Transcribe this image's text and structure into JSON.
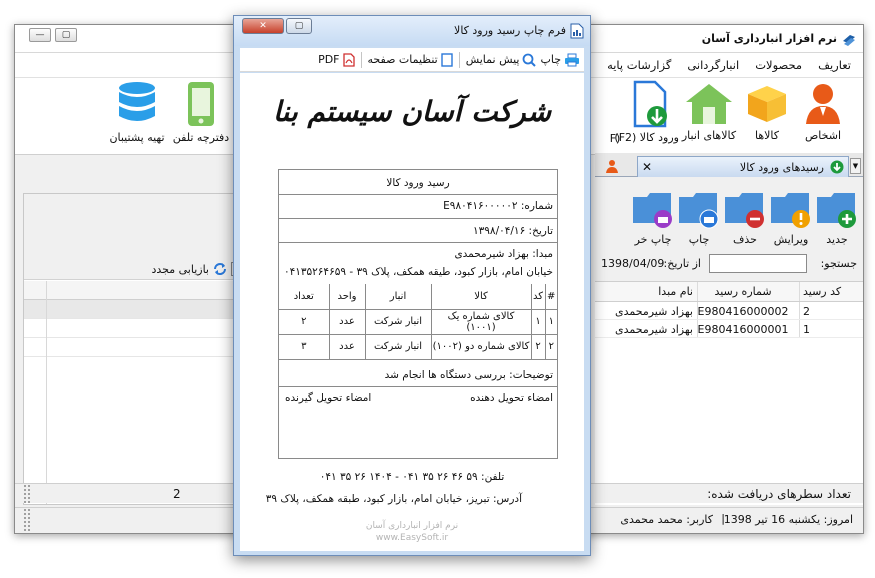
{
  "main_window": {
    "title": "نرم افزار انبارداری آسان",
    "menu": [
      "تعاریف",
      "محصولات",
      "انبارگردانی",
      "گزارشات پایه"
    ],
    "ribbon": [
      {
        "label": "اشخاص",
        "icon": "person-icon"
      },
      {
        "label": "کالاها",
        "icon": "box-icon"
      },
      {
        "label": "کالاهای انبار",
        "icon": "warehouse-icon"
      },
      {
        "label": "ورود کالا (F2)",
        "icon": "goods-receipt-icon"
      },
      {
        "label": "(F",
        "icon": ""
      },
      {
        "label": "دفترچه تلفن",
        "icon": "phone-icon"
      },
      {
        "label": "تهیه پشتیبان",
        "icon": "database-icon"
      }
    ],
    "left_panel": {
      "refresh_label": "بازیابی مجدد"
    },
    "tab": {
      "label": "رسیدهای ورود کالا"
    },
    "toolbar": [
      {
        "label": "جدید",
        "color": "#1e9a3c",
        "icon": "plus-icon"
      },
      {
        "label": "ویرایش",
        "color": "#f0a000",
        "icon": "alert-icon"
      },
      {
        "label": "حذف",
        "color": "#d03030",
        "icon": "minus-icon"
      },
      {
        "label": "چاپ",
        "color": "#2a78d8",
        "icon": "print-icon"
      },
      {
        "label": "چاپ خر",
        "color": "#9a3cc8",
        "icon": "print-icon"
      }
    ],
    "search": {
      "label": "جستجو:",
      "value": "",
      "from_date_label": "از تاریخ:",
      "from_date": "1398/04/09"
    },
    "grid": {
      "columns": [
        "کد رسید",
        "شماره رسید",
        "نام مبدا"
      ],
      "rows": [
        [
          "2",
          "E980416000002",
          "بهزاد شیرمحمدی"
        ],
        [
          "1",
          "E980416000001",
          "بهزاد شیرمحمدی"
        ]
      ]
    },
    "count_label": "تعداد سطرهای دریافت شده:",
    "count_value": "2",
    "status_date": "امروز: یکشنبه 16 تیر 1398",
    "status_user": "کاربر: محمد محمدی"
  },
  "print_dialog": {
    "title": "فرم چاپ رسید ورود کالا",
    "toolbar": {
      "print": "چاپ",
      "preview": "پیش نمایش",
      "page_setup": "تنظیمات صفحه",
      "pdf": "PDF"
    },
    "company": "شرکت آسان سیستم بنا",
    "receipt": {
      "heading": "رسید ورود کالا",
      "number": "شماره: E۹۸۰۴۱۶۰۰۰۰۰۲",
      "date": "تاریخ: ۱۳۹۸/۰۴/۱۶",
      "origin": "مبدا: بهزاد شیرمحمدی",
      "origin_address": "خیابان امام، بازار کبود، طیقه همکف، پلاک ۳۹ - ۰۴۱۳۵۲۶۴۶۵۹",
      "table_header": [
        "#",
        "کد",
        "کالا",
        "انبار",
        "واحد",
        "تعداد"
      ],
      "items": [
        [
          "۱",
          "۱",
          "کالای شماره یک (۱۰۰۱)",
          "انبار شرکت",
          "عدد",
          "۲"
        ],
        [
          "۲",
          "۲",
          "کالای شماره دو (۱۰۰۲)",
          "انبار شرکت",
          "عدد",
          "۳"
        ]
      ],
      "notes": "توضیحات: بررسی دستگاه ها انجام شد",
      "signature_sender": "امضاء تحویل دهنده",
      "signature_receiver": "امضاء تحویل گیرنده"
    },
    "phone": "تلفن: ۵۹ ۴۶ ۲۶ ۳۵ ۰۴۱ - ۱۴۰۴ ۲۶ ۳۵ ۰۴۱",
    "address": "آدرس: تبریز، خیابان امام، بازار کبود، طبقه همکف، پلاک ۳۹",
    "watermark_name": "نرم افزار انبارداری آسان",
    "watermark_url": "www.EasySoft.ir"
  }
}
